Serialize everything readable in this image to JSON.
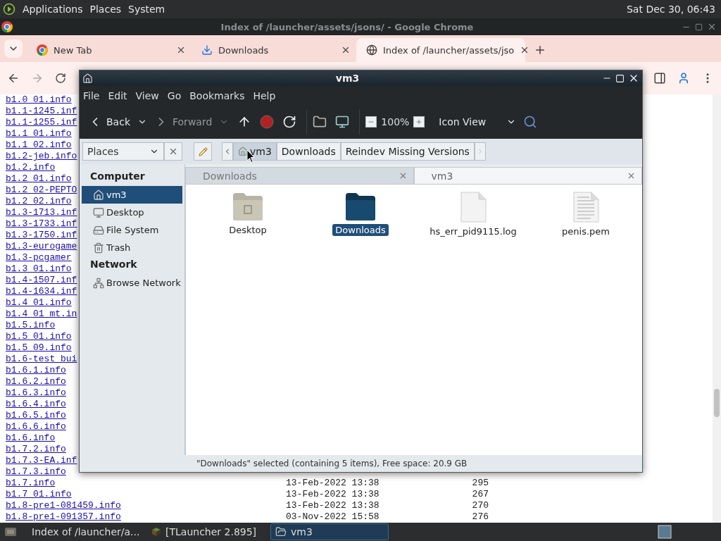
{
  "top_panel": {
    "menus": [
      "Applications",
      "Places",
      "System"
    ],
    "clock": "Sat Dec 30, 06:43"
  },
  "browser": {
    "title": "Index of /launcher/assets/jsons/ - Google Chrome",
    "tabs": [
      {
        "label": "New Tab",
        "kind": "chrome",
        "selected": false
      },
      {
        "label": "Downloads",
        "kind": "download",
        "selected": false
      },
      {
        "label": "Index of /launcher/assets/jso",
        "kind": "globe",
        "selected": true
      }
    ],
    "rows": [
      {
        "name": "b1.0_01.info"
      },
      {
        "name": "b1.1-1245.inf"
      },
      {
        "name": "b1.1-1255.inf"
      },
      {
        "name": "b1.1_01.info"
      },
      {
        "name": "b1.1_02.info"
      },
      {
        "name": "b1.2-jeb.info"
      },
      {
        "name": "b1.2.info"
      },
      {
        "name": "b1.2_01.info"
      },
      {
        "name": "b1.2_02-PEPTO"
      },
      {
        "name": "b1.2_02.info"
      },
      {
        "name": "b1.3-1713.inf"
      },
      {
        "name": "b1.3-1733.inf"
      },
      {
        "name": "b1.3-1750.inf"
      },
      {
        "name": "b1.3-eurogame"
      },
      {
        "name": "b1.3-pcgamer"
      },
      {
        "name": "b1.3_01.info"
      },
      {
        "name": "b1.4-1507.inf"
      },
      {
        "name": "b1.4-1634.inf"
      },
      {
        "name": "b1.4_01.info"
      },
      {
        "name": "b1.4_01_mt.in"
      },
      {
        "name": "b1.5.info"
      },
      {
        "name": "b1.5_01.info"
      },
      {
        "name": "b1.5_09.info"
      },
      {
        "name": "b1.6-test_bui"
      },
      {
        "name": "b1.6.1.info"
      },
      {
        "name": "b1.6.2.info"
      },
      {
        "name": "b1.6.3.info"
      },
      {
        "name": "b1.6.4.info"
      },
      {
        "name": "b1.6.5.info"
      },
      {
        "name": "b1.6.6.info"
      },
      {
        "name": "b1.6.info"
      },
      {
        "name": "b1.7.2.info"
      },
      {
        "name": "b1.7.3-EA.inf"
      },
      {
        "name": "b1.7.3.info"
      },
      {
        "name": "b1.7.info",
        "date": "13-Feb-2022 13:38",
        "size": "295"
      },
      {
        "name": "b1.7_01.info",
        "date": "13-Feb-2022 13:38",
        "size": "267"
      },
      {
        "name": "b1.8-pre1-081459.info",
        "date": "13-Feb-2022 13:38",
        "size": "270"
      },
      {
        "name": "b1.8-pre1-091357.info",
        "date": "03-Nov-2022 15:58",
        "size": "276"
      }
    ]
  },
  "file_manager": {
    "title": "vm3",
    "menus": [
      "File",
      "Edit",
      "View",
      "Go",
      "Bookmarks",
      "Help"
    ],
    "toolbar": {
      "back": {
        "label": "Back",
        "disabled": false
      },
      "forward": {
        "label": "Forward",
        "disabled": true
      },
      "zoom": "100%",
      "view": "Icon View"
    },
    "sidebar": {
      "selector": "Places",
      "sections": [
        {
          "heading": "Computer",
          "items": [
            {
              "label": "vm3",
              "kind": "home",
              "selected": true
            },
            {
              "label": "Desktop",
              "kind": "desktop",
              "selected": false
            },
            {
              "label": "File System",
              "kind": "drive",
              "selected": false
            },
            {
              "label": "Trash",
              "kind": "trash",
              "selected": false
            }
          ]
        },
        {
          "heading": "Network",
          "items": [
            {
              "label": "Browse Network",
              "kind": "network",
              "selected": false
            }
          ]
        }
      ]
    },
    "path": [
      {
        "label": "vm3",
        "selected": true
      },
      {
        "label": "Downloads",
        "selected": false
      },
      {
        "label": "Reindev Missing Versions",
        "selected": false
      }
    ],
    "tabs": [
      {
        "label": "Downloads",
        "selected": false
      },
      {
        "label": "vm3",
        "selected": true
      }
    ],
    "files": [
      {
        "name": "Desktop",
        "kind": "desktop-folder",
        "selected": false
      },
      {
        "name": "Downloads",
        "kind": "folder",
        "selected": true
      },
      {
        "name": "hs_err_pid9115.log",
        "kind": "blank-file",
        "selected": false
      },
      {
        "name": "penis.pem",
        "kind": "text-file",
        "selected": false
      }
    ],
    "status": "\"Downloads\" selected (containing 5 items), Free space: 20.9 GB"
  },
  "taskbar": {
    "items": [
      {
        "label": "Index of /launcher/a...",
        "kind": "chrome",
        "selected": false
      },
      {
        "label": "[TLauncher 2.895]",
        "kind": "app",
        "selected": false
      },
      {
        "label": "vm3",
        "kind": "folder",
        "selected": true
      }
    ]
  }
}
